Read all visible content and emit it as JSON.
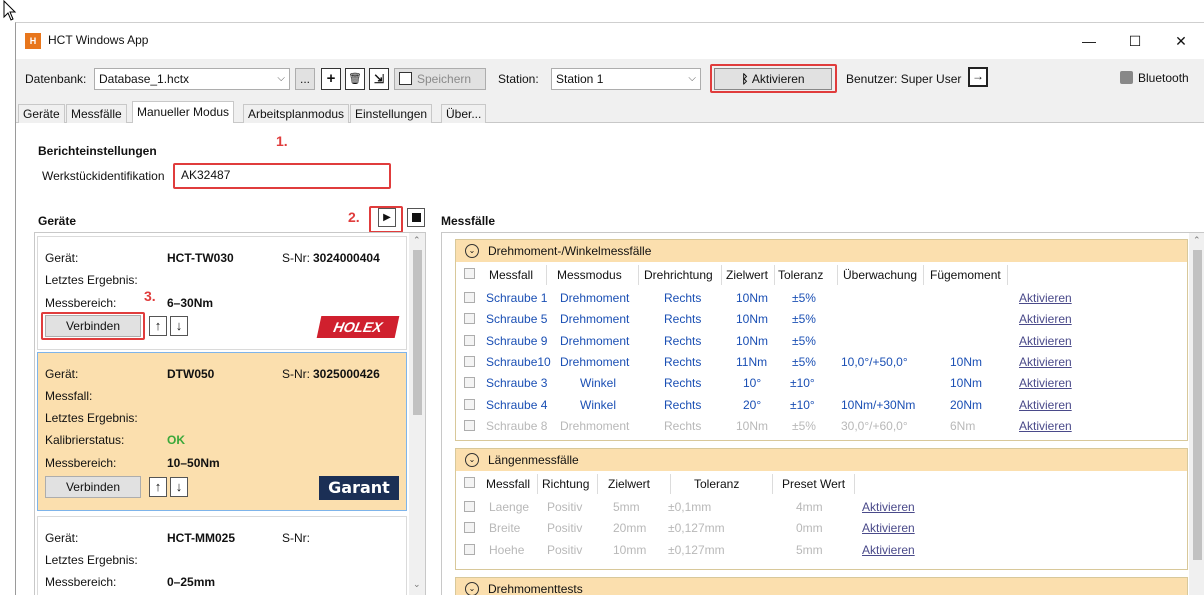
{
  "window": {
    "title": "HCT Windows App",
    "minimize": "—",
    "maximize": "☐",
    "close": "✕"
  },
  "toolbar": {
    "db_label": "Datenbank:",
    "db_value": "Database_1.hctx",
    "browse": "...",
    "add": "+",
    "delete": "🗑",
    "import": "⇲",
    "save": "Speichern",
    "station_label": "Station:",
    "station_value": "Station 1",
    "activate": "Aktivieren",
    "user_label": "Benutzer: Super User",
    "bluetooth": "Bluetooth"
  },
  "tabs": [
    "Geräte",
    "Messfälle",
    "Manueller Modus",
    "Arbeitsplanmodus",
    "Einstellungen",
    "Über..."
  ],
  "report": {
    "title": "Berichteinstellungen",
    "field_label": "Werkstückidentifikation",
    "field_value": "AK32487"
  },
  "steps": {
    "s1": "1.",
    "s2": "2.",
    "s3": "3."
  },
  "devices_title": "Geräte",
  "devices": [
    {
      "geraet_label": "Gerät:",
      "geraet": "HCT-TW030",
      "snr_label": "S-Nr:",
      "snr": "3024000404",
      "result_label": "Letztes Ergebnis:",
      "range_label": "Messbereich:",
      "range": "6–30Nm",
      "connect": "Verbinden",
      "brand": "HOLEX"
    },
    {
      "geraet_label": "Gerät:",
      "geraet": "DTW050",
      "snr_label": "S-Nr:",
      "snr": "3025000426",
      "messfall_label": "Messfall:",
      "result_label": "Letztes Ergebnis:",
      "calib_label": "Kalibrierstatus:",
      "calib": "OK",
      "range_label": "Messbereich:",
      "range": "10–50Nm",
      "connect": "Verbinden",
      "brand": "Garant"
    },
    {
      "geraet_label": "Gerät:",
      "geraet": "HCT-MM025",
      "snr_label": "S-Nr:",
      "result_label": "Letztes Ergebnis:",
      "range_label": "Messbereich:",
      "range": "0–25mm"
    }
  ],
  "cases_title": "Messfälle",
  "torque": {
    "title": "Drehmoment-/Winkelmessfälle",
    "headers": [
      "Messfall",
      "Messmodus",
      "Drehrichtung",
      "Zielwert",
      "Toleranz",
      "Überwachung",
      "Fügemoment"
    ],
    "rows": [
      [
        "Schraube 1",
        "Drehmoment",
        "Rechts",
        "10Nm",
        "±5%",
        "",
        "",
        "Aktivieren"
      ],
      [
        "Schraube 5",
        "Drehmoment",
        "Rechts",
        "10Nm",
        "±5%",
        "",
        "",
        "Aktivieren"
      ],
      [
        "Schraube 9",
        "Drehmoment",
        "Rechts",
        "10Nm",
        "±5%",
        "",
        "",
        "Aktivieren"
      ],
      [
        "Schraube10",
        "Drehmoment",
        "Rechts",
        "11Nm",
        "±5%",
        "10,0°/+50,0°",
        "10Nm",
        "Aktivieren"
      ],
      [
        "Schraube 3",
        "Winkel",
        "Rechts",
        "10°",
        "±10°",
        "",
        "10Nm",
        "Aktivieren"
      ],
      [
        "Schraube 4",
        "Winkel",
        "Rechts",
        "20°",
        "±10°",
        "10Nm/+30Nm",
        "20Nm",
        "Aktivieren"
      ],
      [
        "Schraube 8",
        "Drehmoment",
        "Rechts",
        "10Nm",
        "±5%",
        "30,0°/+60,0°",
        "6Nm",
        "Aktivieren"
      ]
    ]
  },
  "length": {
    "title": "Längenmessfälle",
    "headers": [
      "Messfall",
      "Richtung",
      "Zielwert",
      "Toleranz",
      "Preset Wert"
    ],
    "rows": [
      [
        "Laenge",
        "Positiv",
        "5mm",
        "±0,1mm",
        "4mm",
        "Aktivieren"
      ],
      [
        "Breite",
        "Positiv",
        "20mm",
        "±0,127mm",
        "0mm",
        "Aktivieren"
      ],
      [
        "Hoehe",
        "Positiv",
        "10mm",
        "±0,127mm",
        "5mm",
        "Aktivieren"
      ]
    ]
  },
  "tests": {
    "title": "Drehmomenttests"
  },
  "colors": {
    "accent_orange": "#fbdfae",
    "highlight_red": "#e03c3c",
    "ok_green": "#3aa83a",
    "holex_red": "#d0202e",
    "garant_navy": "#1b2f55"
  }
}
